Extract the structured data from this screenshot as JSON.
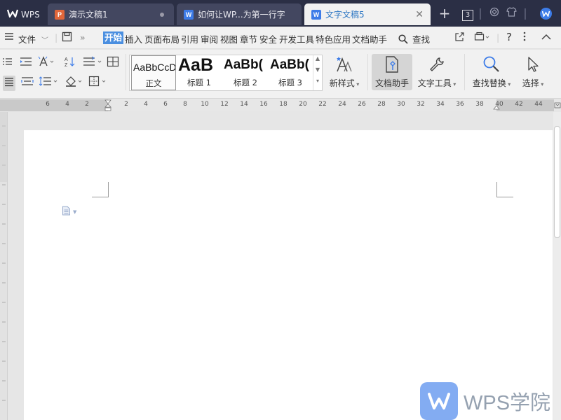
{
  "tabs": [
    {
      "label": "WPS",
      "icon": "wps-logo-icon"
    },
    {
      "label": "演示文稿1",
      "icon": "presentation-icon",
      "icon_letter": "P",
      "icon_color": "#e0663a"
    },
    {
      "label": "如何让WP...为第一行字",
      "icon": "writer-doc-icon",
      "icon_letter": "W",
      "icon_color": "#3d7ce8"
    },
    {
      "label": "文字文稿5",
      "icon": "writer-doc-icon",
      "icon_letter": "W",
      "icon_color": "#3d7ce8",
      "active": true
    }
  ],
  "titlebar": {
    "add_tab": "+",
    "window_count": "3"
  },
  "menu": {
    "file_label": "文件",
    "items": [
      "开始",
      "插入",
      "页面布局",
      "引用",
      "审阅",
      "视图",
      "章节",
      "安全",
      "开发工具",
      "特色应用",
      "文档助手"
    ],
    "active_item": "开始",
    "search_label": "查找"
  },
  "ribbon": {
    "styles": [
      {
        "preview": "AaBbCcD",
        "label": "正文"
      },
      {
        "preview": "AaB",
        "label": "标题 1"
      },
      {
        "preview": "AaBb(",
        "label": "标题 2"
      },
      {
        "preview": "AaBb(",
        "label": "标题 3"
      }
    ],
    "new_style_label": "新样式",
    "doc_assistant_label": "文档助手",
    "text_tools_label": "文字工具",
    "find_replace_label": "查找替换",
    "select_label": "选择"
  },
  "ruler": {
    "ticks": [
      "6",
      "4",
      "2",
      "2",
      "4",
      "6",
      "8",
      "10",
      "12",
      "14",
      "16",
      "18",
      "20",
      "22",
      "24",
      "26",
      "28",
      "30",
      "32",
      "34",
      "36",
      "38",
      "40",
      "42",
      "44"
    ]
  },
  "watermark": {
    "text": "WPS学院"
  },
  "colors": {
    "titlebar_bg": "#2b2f45",
    "accent": "#4b8fe0",
    "page_bg": "#ffffff"
  }
}
